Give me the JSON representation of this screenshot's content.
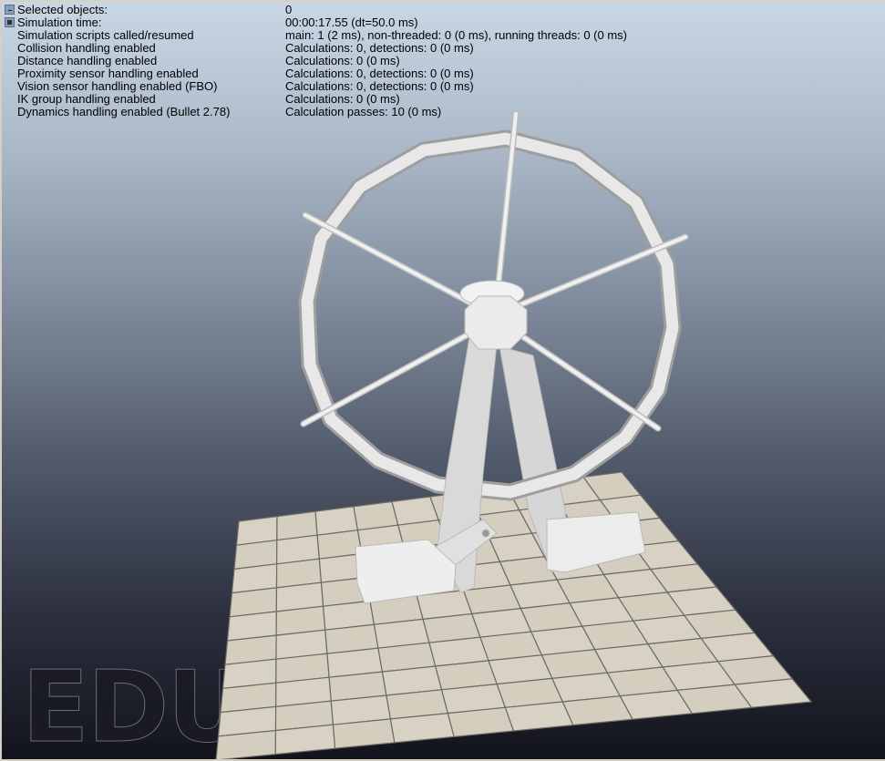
{
  "info_panel": {
    "rows": [
      {
        "label": "Selected objects:",
        "value": "0"
      },
      {
        "label": "Simulation time:",
        "value": "00:00:17.55 (dt=50.0 ms)"
      },
      {
        "label": "Simulation scripts called/resumed",
        "value": "main: 1 (2 ms), non-threaded: 0 (0 ms), running threads: 0 (0 ms)"
      },
      {
        "label": "Collision handling enabled",
        "value": "Calculations: 0, detections: 0 (0 ms)"
      },
      {
        "label": "Distance handling enabled",
        "value": "Calculations: 0 (0 ms)"
      },
      {
        "label": "Proximity sensor handling enabled",
        "value": "Calculations: 0, detections: 0 (0 ms)"
      },
      {
        "label": "Vision sensor handling enabled (FBO)",
        "value": "Calculations: 0, detections: 0 (0 ms)"
      },
      {
        "label": "IK group handling enabled",
        "value": "Calculations: 0 (0 ms)"
      },
      {
        "label": "Dynamics handling enabled (Bullet 2.78)",
        "value": "Calculation passes: 10 (0 ms)"
      }
    ]
  },
  "watermark": "EDU",
  "colors": {
    "floor_tile": "#d8d2c4",
    "model": "#e6e6e6"
  }
}
